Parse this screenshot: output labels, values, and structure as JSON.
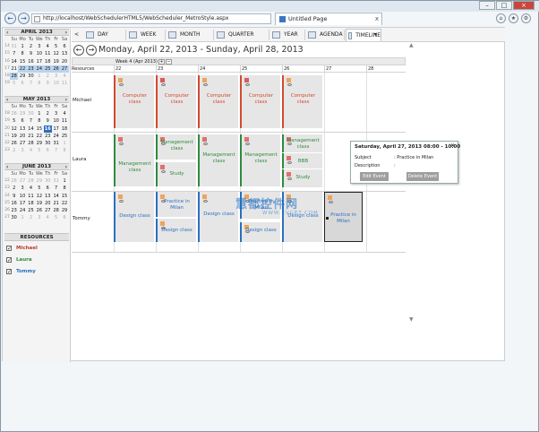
{
  "browser": {
    "url": "http://localhost/WebSchedulerHTML5/WebScheduler_MetroStyle.aspx",
    "tab_title": "Untitled Page",
    "tab_close": "x"
  },
  "toolbar": {
    "prev": "<",
    "buttons": [
      "DAY",
      "WEEK",
      "MONTH",
      "QUARTER",
      "YEAR",
      "AGENDA",
      "TIMELINE"
    ],
    "active": "TIMELINE",
    "more": "▾"
  },
  "range_title": "Monday, April 22, 2013 - Sunday, April 28, 2013",
  "sidebar": {
    "weekday_headers": [
      "Su",
      "Mo",
      "Tu",
      "We",
      "Th",
      "Fr",
      "Sa"
    ],
    "months": [
      {
        "title": "APRIL 2013",
        "weeks": [
          {
            "wk": "14",
            "days": [
              "31",
              "1",
              "2",
              "3",
              "4",
              "5",
              "6"
            ]
          },
          {
            "wk": "15",
            "days": [
              "7",
              "8",
              "9",
              "10",
              "11",
              "12",
              "13"
            ]
          },
          {
            "wk": "16",
            "days": [
              "14",
              "15",
              "16",
              "17",
              "18",
              "19",
              "20"
            ]
          },
          {
            "wk": "17",
            "days": [
              "21",
              "22",
              "23",
              "24",
              "25",
              "26",
              "27"
            ]
          },
          {
            "wk": "18",
            "days": [
              "28",
              "29",
              "30",
              "1",
              "2",
              "3",
              "4"
            ]
          },
          {
            "wk": "19",
            "days": [
              "5",
              "6",
              "7",
              "8",
              "9",
              "10",
              "11"
            ]
          }
        ]
      },
      {
        "title": "MAY 2013",
        "weeks": [
          {
            "wk": "18",
            "days": [
              "28",
              "29",
              "30",
              "1",
              "2",
              "3",
              "4"
            ]
          },
          {
            "wk": "19",
            "days": [
              "5",
              "6",
              "7",
              "8",
              "9",
              "10",
              "11"
            ]
          },
          {
            "wk": "20",
            "days": [
              "12",
              "13",
              "14",
              "15",
              "16",
              "17",
              "18"
            ]
          },
          {
            "wk": "21",
            "days": [
              "19",
              "20",
              "21",
              "22",
              "23",
              "24",
              "25"
            ]
          },
          {
            "wk": "22",
            "days": [
              "26",
              "27",
              "28",
              "29",
              "30",
              "31",
              "1"
            ]
          },
          {
            "wk": "23",
            "days": [
              "2",
              "3",
              "4",
              "5",
              "6",
              "7",
              "8"
            ]
          }
        ]
      },
      {
        "title": "JUNE 2013",
        "weeks": [
          {
            "wk": "22",
            "days": [
              "26",
              "27",
              "28",
              "29",
              "30",
              "31",
              "1"
            ]
          },
          {
            "wk": "23",
            "days": [
              "2",
              "3",
              "4",
              "5",
              "6",
              "7",
              "8"
            ]
          },
          {
            "wk": "24",
            "days": [
              "9",
              "10",
              "11",
              "12",
              "13",
              "14",
              "15"
            ]
          },
          {
            "wk": "25",
            "days": [
              "16",
              "17",
              "18",
              "19",
              "20",
              "21",
              "22"
            ]
          },
          {
            "wk": "26",
            "days": [
              "23",
              "24",
              "25",
              "26",
              "27",
              "28",
              "29"
            ]
          },
          {
            "wk": "27",
            "days": [
              "30",
              "1",
              "2",
              "3",
              "4",
              "5",
              "6"
            ]
          }
        ]
      }
    ],
    "resources_title": "RESOURCES",
    "resources": [
      {
        "name": "Michael",
        "color": "#c0392b"
      },
      {
        "name": "Laura",
        "color": "#2e8b3e"
      },
      {
        "name": "Tommy",
        "color": "#2a6fc1"
      }
    ]
  },
  "timeline": {
    "week_label": "Week 4 (Apr 2013)",
    "resources_label": "Resources",
    "days": [
      "22",
      "23",
      "24",
      "25",
      "26",
      "27",
      "28"
    ],
    "rows": [
      "Michael",
      "Laura",
      "Tommy"
    ]
  },
  "events": {
    "michael": [
      "Computer class",
      "Computer class",
      "Computer class",
      "Computer class",
      "Computer class"
    ],
    "laura": [
      "Management class",
      "Management class",
      "Study",
      "Management class",
      "Management class",
      "Management class",
      "BBB",
      "Study"
    ],
    "tommy": [
      "Design class",
      "Practice in Milan",
      "Design class",
      "Design class",
      "Practice in Milan",
      "Design class",
      "Design class",
      "Practice in Milan"
    ]
  },
  "popup": {
    "title": "Saturday, April 27, 2013 08:00 - 10:00",
    "subject_label": "Subject",
    "subject_value": ": Practice in Milan",
    "description_label": "Description",
    "description_value": ":",
    "edit_button": "Edit Event",
    "delete_button": "Delete Event",
    "close": "×"
  },
  "watermark": {
    "main": "慧都控件网",
    "sub": "WWW.EVGET.COM"
  },
  "colors": {
    "michael": "#d24a2e",
    "laura": "#2e8b3e",
    "tommy": "#2a6fc1"
  }
}
